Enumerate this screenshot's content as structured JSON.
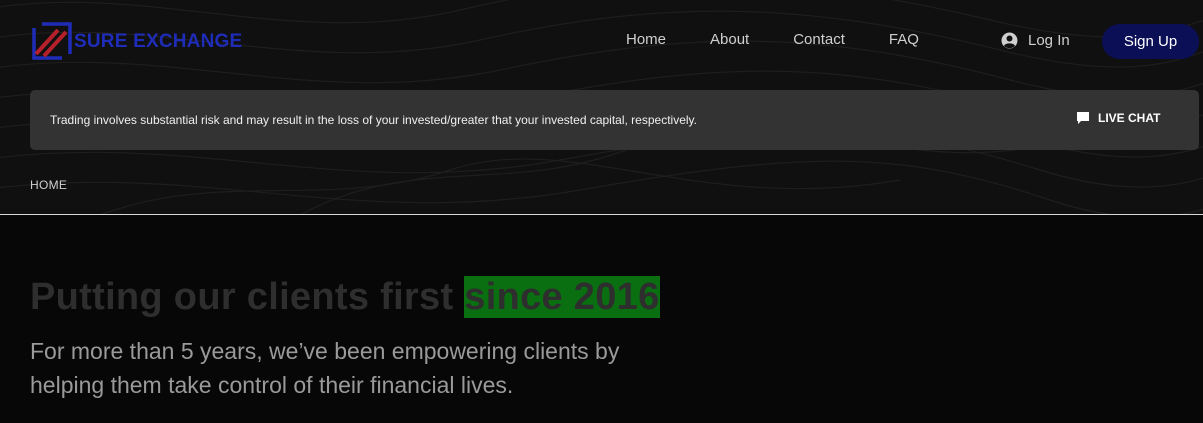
{
  "brand": {
    "name": "SURE EXCHANGE",
    "logo_icon": "sure-exchange-logo",
    "primary_color": "#1f2cb8",
    "accent_color": "#b5202a"
  },
  "nav": {
    "items": [
      {
        "label": "Home"
      },
      {
        "label": "About"
      },
      {
        "label": "Contact"
      },
      {
        "label": "FAQ"
      }
    ],
    "login_label": "Log In",
    "login_icon": "user-circle-icon",
    "signup_label": "Sign Up"
  },
  "risk_notice": {
    "text": "Trading involves substantial risk and may result in the loss of your invested/greater that your invested capital, respectively.",
    "live_chat_label": "LIVE CHAT",
    "live_chat_icon": "chat-bubble-icon"
  },
  "breadcrumb": {
    "current": "HOME"
  },
  "hero": {
    "title_prefix": "Putting our clients first ",
    "title_highlight": "since 2016",
    "highlight_color": "#0a6f10",
    "subtitle": "For more than 5 years, we’ve been empowering clients by helping them take control of their financial lives."
  }
}
